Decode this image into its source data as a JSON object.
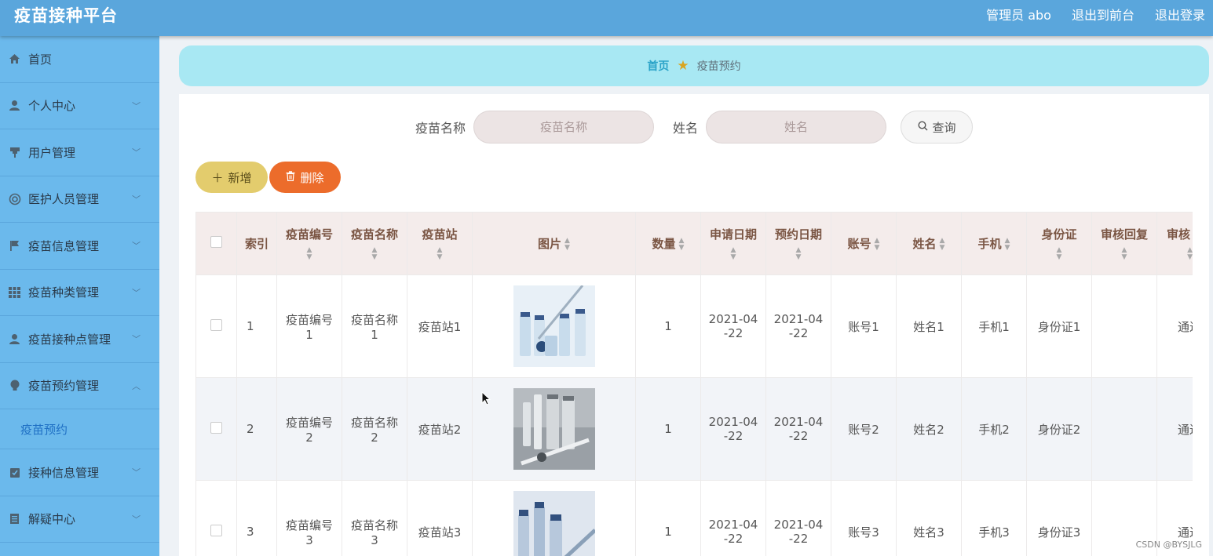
{
  "header": {
    "brand": "疫苗接种平台",
    "admin": "管理员 abo",
    "to_front": "退出到前台",
    "logout": "退出登录"
  },
  "sidebar": {
    "items": [
      {
        "label": "首页",
        "icon": "home-icon"
      },
      {
        "label": "个人中心",
        "icon": "user-icon"
      },
      {
        "label": "用户管理",
        "icon": "pin-icon"
      },
      {
        "label": "医护人员管理",
        "icon": "support-icon"
      },
      {
        "label": "疫苗信息管理",
        "icon": "flag-icon"
      },
      {
        "label": "疫苗种类管理",
        "icon": "grid-icon"
      },
      {
        "label": "疫苗接种点管理",
        "icon": "user-icon"
      },
      {
        "label": "疫苗预约管理",
        "icon": "bulb-icon"
      },
      {
        "label": "接种信息管理",
        "icon": "check-icon"
      },
      {
        "label": "解疑中心",
        "icon": "doc-icon"
      }
    ],
    "sub_active": "疫苗预约"
  },
  "breadcrumb": {
    "home": "首页",
    "current": "疫苗预约"
  },
  "search": {
    "vaccine_name_label": "疫苗名称",
    "vaccine_name_placeholder": "疫苗名称",
    "name_label": "姓名",
    "name_placeholder": "姓名",
    "query_label": "查询"
  },
  "actions": {
    "add_label": "新增",
    "delete_label": "删除"
  },
  "table": {
    "columns": [
      "索引",
      "疫苗编号",
      "疫苗名称",
      "疫苗站",
      "图片",
      "数量",
      "申请日期",
      "预约日期",
      "账号",
      "姓名",
      "手机",
      "身份证",
      "审核回复",
      "审核"
    ],
    "rows": [
      {
        "index": "1",
        "code_a": "疫苗编号",
        "code_b": "1",
        "name_a": "疫苗名称",
        "name_b": "1",
        "station": "疫苗站1",
        "qty": "1",
        "apply_a": "2021-04",
        "apply_b": "-22",
        "appt_a": "2021-04",
        "appt_b": "-22",
        "account": "账号1",
        "person": "姓名1",
        "phone": "手机1",
        "idcard": "身份证1",
        "reply": "",
        "status": "通过"
      },
      {
        "index": "2",
        "code_a": "疫苗编号",
        "code_b": "2",
        "name_a": "疫苗名称",
        "name_b": "2",
        "station": "疫苗站2",
        "qty": "1",
        "apply_a": "2021-04",
        "apply_b": "-22",
        "appt_a": "2021-04",
        "appt_b": "-22",
        "account": "账号2",
        "person": "姓名2",
        "phone": "手机2",
        "idcard": "身份证2",
        "reply": "",
        "status": "通过"
      },
      {
        "index": "3",
        "code_a": "疫苗编号",
        "code_b": "3",
        "name_a": "疫苗名称",
        "name_b": "3",
        "station": "疫苗站3",
        "qty": "1",
        "apply_a": "2021-04",
        "apply_b": "-22",
        "appt_a": "2021-04",
        "appt_b": "-22",
        "account": "账号3",
        "person": "姓名3",
        "phone": "手机3",
        "idcard": "身份证3",
        "reply": "",
        "status": "通过"
      }
    ]
  },
  "watermark": "CSDN @BYSJLG"
}
